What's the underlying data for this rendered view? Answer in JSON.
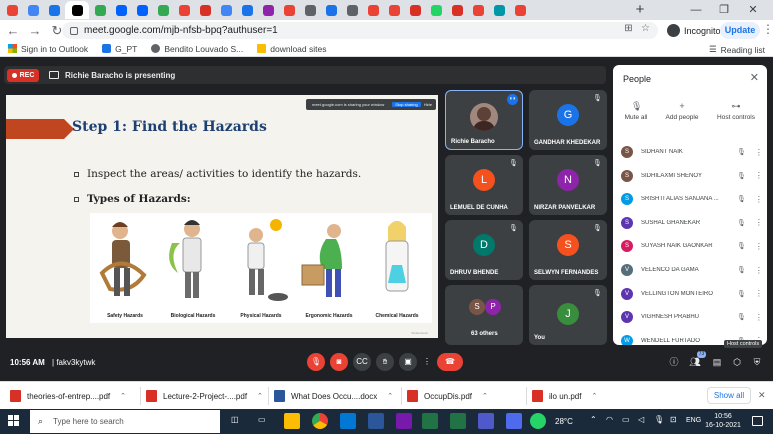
{
  "browser": {
    "tabs": [
      {
        "color": "#ea4335"
      },
      {
        "color": "#4285f4"
      },
      {
        "color": "#1a73e8"
      },
      {
        "color": "#000000"
      },
      {
        "color": "#34a853"
      },
      {
        "color": "#0061ff"
      },
      {
        "color": "#0061ff"
      },
      {
        "color": "#34a853"
      },
      {
        "color": "#ea4335"
      },
      {
        "color": "#d93025"
      },
      {
        "color": "#4285f4"
      },
      {
        "color": "#1a73e8"
      },
      {
        "color": "#8e24aa"
      },
      {
        "color": "#ea4335"
      },
      {
        "color": "#5f6368"
      },
      {
        "color": "#1a73e8"
      },
      {
        "color": "#5f6368"
      },
      {
        "color": "#ea4335"
      },
      {
        "color": "#ea4335"
      },
      {
        "color": "#d93025"
      },
      {
        "color": "#25d366"
      },
      {
        "color": "#d93025"
      },
      {
        "color": "#ea4335"
      },
      {
        "color": "#0097a7"
      },
      {
        "color": "#ea4335"
      }
    ],
    "url": "meet.google.com/mjb-nfsb-bpq?authuser=1",
    "incognito_label": "Incognito",
    "update_label": "Update",
    "bookmarks": [
      "Sign in to Outlook",
      "G_PT",
      "Bendito Louvado S...",
      "download sites"
    ],
    "reading_list": "Reading list"
  },
  "meet": {
    "rec_label": "REC",
    "presenting_text": "Richie Baracho is presenting",
    "slide": {
      "sharebar_text": "meet.google.com is sharing your window",
      "sharebar_stop": "Stop sharing",
      "sharebar_hide": "Hide",
      "title": "Step 1: Find the Hazards",
      "bullets": [
        "Inspect the areas/ activities to identify the hazards.",
        "Types of Hazards:"
      ],
      "hazards": [
        "Safety Hazards",
        "Biological Hazards",
        "Physical Hazards",
        "Ergonomic Hazards",
        "Chemical Hazards"
      ],
      "credit": "Shutterstock"
    },
    "tiles": [
      {
        "name": "Richie Baracho",
        "avatar": "",
        "color": "#5f6368"
      },
      {
        "name": "GANDHAR KHEDEKAR",
        "avatar": "G",
        "color": "#1a73e8"
      },
      {
        "name": "LEMUEL DE CUNHA",
        "avatar": "L",
        "color": "#f4511e"
      },
      {
        "name": "NIRZAR PANVELKAR",
        "avatar": "N",
        "color": "#8e24aa"
      },
      {
        "name": "DHRUV BHENDE",
        "avatar": "D",
        "color": "#00796b"
      },
      {
        "name": "SELWYN FERNANDES",
        "avatar": "S",
        "color": "#f4511e"
      },
      {
        "name": "63 others",
        "avatar": "S",
        "avatar2": "P",
        "color": "#795548",
        "color2": "#8e24aa"
      },
      {
        "name": "You",
        "avatar": "J",
        "color": "#388e3c"
      }
    ],
    "people_panel": {
      "title": "People",
      "actions": [
        "Mute all",
        "Add people",
        "Host controls"
      ],
      "people": [
        {
          "name": "SIDHANT NAIK",
          "initial": "S",
          "color": "#795548"
        },
        {
          "name": "SIDHILAXMI SHENOY",
          "initial": "S",
          "color": "#795548"
        },
        {
          "name": "SRISHTI ALIAS SANJANA ...",
          "initial": "S",
          "color": "#039be5"
        },
        {
          "name": "SUSHAL GHANEKAR",
          "initial": "S",
          "color": "#5e35b1"
        },
        {
          "name": "SUYASH NAIK GAONKAR",
          "initial": "S",
          "color": "#d81b60"
        },
        {
          "name": "VELENCO DA GAMA",
          "initial": "V",
          "color": "#546e7a"
        },
        {
          "name": "VELLINGTON MONTEIRO",
          "initial": "V",
          "color": "#5e35b1"
        },
        {
          "name": "VIGHNESH PRABHU",
          "initial": "V",
          "color": "#5e35b1"
        },
        {
          "name": "WENDELL FURTADO",
          "initial": "W",
          "color": "#039be5"
        }
      ],
      "tooltip": "Host controls"
    },
    "bottom": {
      "time": "10:56 AM",
      "separator": "|",
      "code": "fakv3kytwk",
      "people_badge": "73"
    }
  },
  "downloads": {
    "items": [
      {
        "name": "theories-of-entrep....pdf",
        "type": "pdf"
      },
      {
        "name": "Lecture-2-Project-....pdf",
        "type": "pdf"
      },
      {
        "name": "What Does Occu....docx",
        "type": "word"
      },
      {
        "name": "OccupDis.pdf",
        "type": "pdf"
      },
      {
        "name": "ilo un.pdf",
        "type": "pdf"
      }
    ],
    "show_all": "Show all"
  },
  "taskbar": {
    "search_placeholder": "Type here to search",
    "weather": "28°C",
    "lang": "ENG",
    "time": "10:56",
    "date": "16-10-2021"
  }
}
